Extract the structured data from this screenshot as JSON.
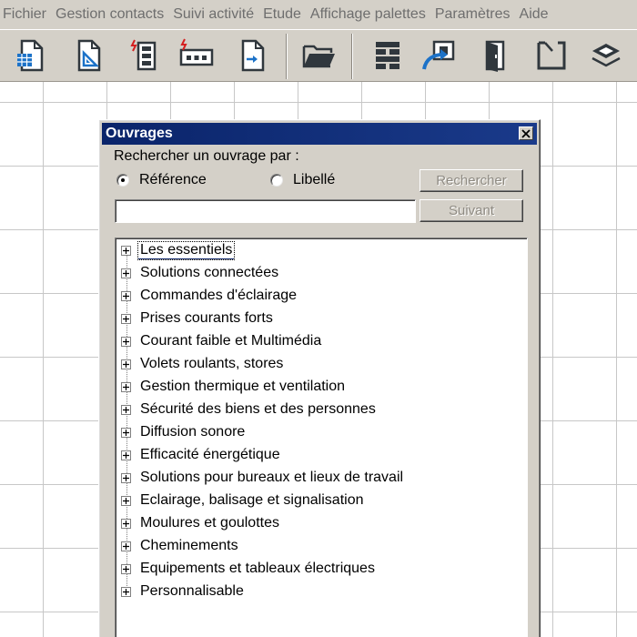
{
  "menubar": {
    "items": [
      "Fichier",
      "Gestion contacts",
      "Suivi activité",
      "Etude",
      "Affichage palettes",
      "Paramètres",
      "Aide"
    ]
  },
  "toolbar": {
    "tools": [
      {
        "icon": "document-table-icon"
      },
      {
        "icon": "document-ruler-icon"
      },
      {
        "icon": "electrical-panel-icon"
      },
      {
        "icon": "electrical-strip-icon"
      },
      {
        "icon": "document-arrow-icon"
      },
      {
        "icon": "folder-open-icon"
      },
      {
        "icon": "wall-brick-icon"
      },
      {
        "icon": "export-arrow-icon"
      },
      {
        "icon": "door-icon"
      },
      {
        "icon": "room-outline-icon"
      },
      {
        "icon": "layers-icon"
      }
    ]
  },
  "dialog": {
    "title": "Ouvrages",
    "search_label": "Rechercher un ouvrage par :",
    "radio_reference": "Référence",
    "radio_libelle": "Libellé",
    "selected_radio": "Référence",
    "search_button": "Rechercher",
    "next_button": "Suivant",
    "search_value": "",
    "tree_items": [
      "Les essentiels",
      "Solutions connectées",
      "Commandes d'éclairage",
      "Prises courants forts",
      "Courant faible et Multimédia",
      "Volets roulants, stores",
      "Gestion thermique et ventilation",
      "Sécurité des biens et des personnes",
      "Diffusion sonore",
      "Efficacité énergétique",
      "Solutions pour bureaux et lieux de travail",
      "Eclairage, balisage et signalisation",
      "Moulures et goulottes",
      "Cheminements",
      "Equipements et tableaux électriques",
      "Personnalisable"
    ],
    "selected_item": "Les essentiels"
  },
  "colors": {
    "title_bar": "#0a246a",
    "window_face": "#d4d0c8",
    "icon_blue": "#1c72c8",
    "icon_red": "#d42020",
    "icon_dark": "#30373d"
  }
}
